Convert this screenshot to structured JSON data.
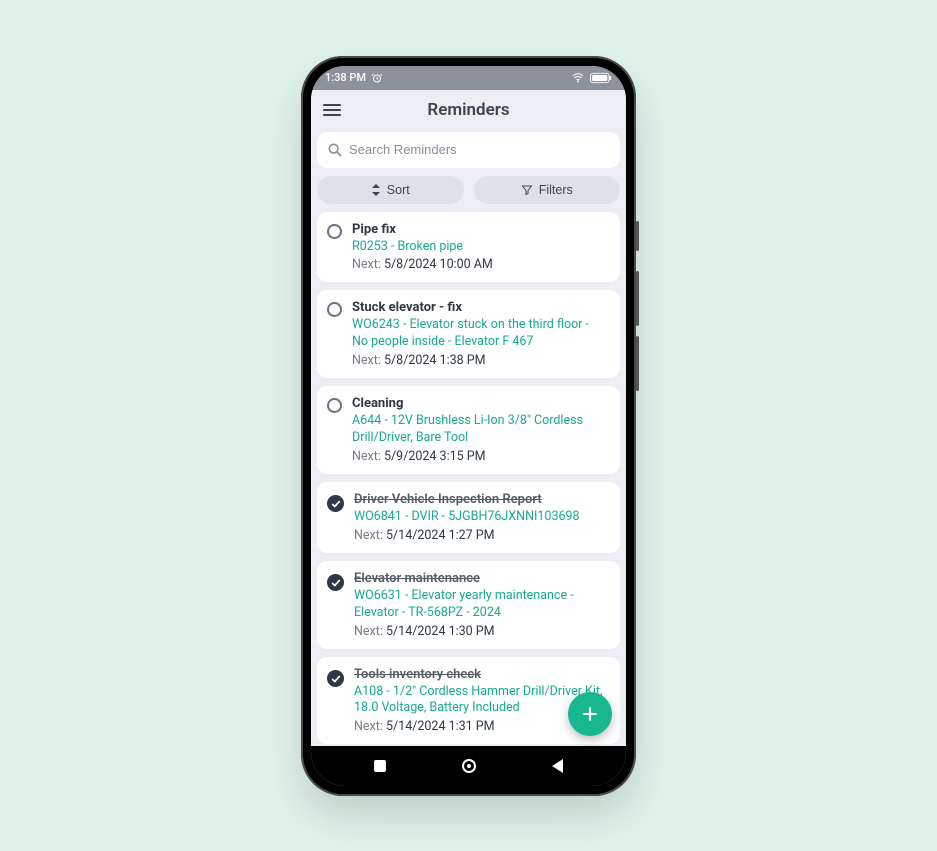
{
  "status": {
    "time": "1:38 PM"
  },
  "header": {
    "title": "Reminders"
  },
  "search": {
    "placeholder": "Search Reminders"
  },
  "toolbar": {
    "sort": "Sort",
    "filters": "Filters"
  },
  "next_label": "Next:",
  "icons": {
    "menu": "menu-icon",
    "search": "search-icon",
    "sort": "sort-icon",
    "filter": "filter-icon",
    "add": "plus-icon",
    "alarm": "alarm-icon",
    "wifi": "wifi-icon",
    "battery": "battery-icon",
    "check": "check-icon"
  },
  "reminders": [
    {
      "title": "Pipe fix",
      "completed": false,
      "link": "R0253 - Broken pipe",
      "next": "5/8/2024 10:00 AM"
    },
    {
      "title": "Stuck elevator - fix",
      "completed": false,
      "link": "WO6243 - Elevator stuck on the third floor - No people inside - Elevator F 467",
      "next": "5/8/2024 1:38 PM"
    },
    {
      "title": "Cleaning",
      "completed": false,
      "link": "A644 - 12V Brushless Li-Ion 3/8\" Cordless Drill/Driver, Bare Tool",
      "next": "5/9/2024 3:15 PM"
    },
    {
      "title": "Driver Vehicle Inspection Report",
      "completed": true,
      "link": "WO6841 - DVIR - 5JGBH76JXNNI103698",
      "next": "5/14/2024 1:27 PM"
    },
    {
      "title": "Elevator maintenance",
      "completed": true,
      "link": "WO6631 - Elevator yearly maintenance - Elevator - TR-568PZ - 2024",
      "next": "5/14/2024 1:30 PM"
    },
    {
      "title": "Tools inventory check",
      "completed": true,
      "link": "A108 - 1/2\" Cordless Hammer Drill/Driver Kit, 18.0 Voltage, Battery Included",
      "next": "5/14/2024 1:31 PM"
    }
  ],
  "colors": {
    "accent": "#17b890",
    "link": "#17a98f",
    "bg": "#eceef3",
    "page_bg": "#e0f3eb"
  }
}
